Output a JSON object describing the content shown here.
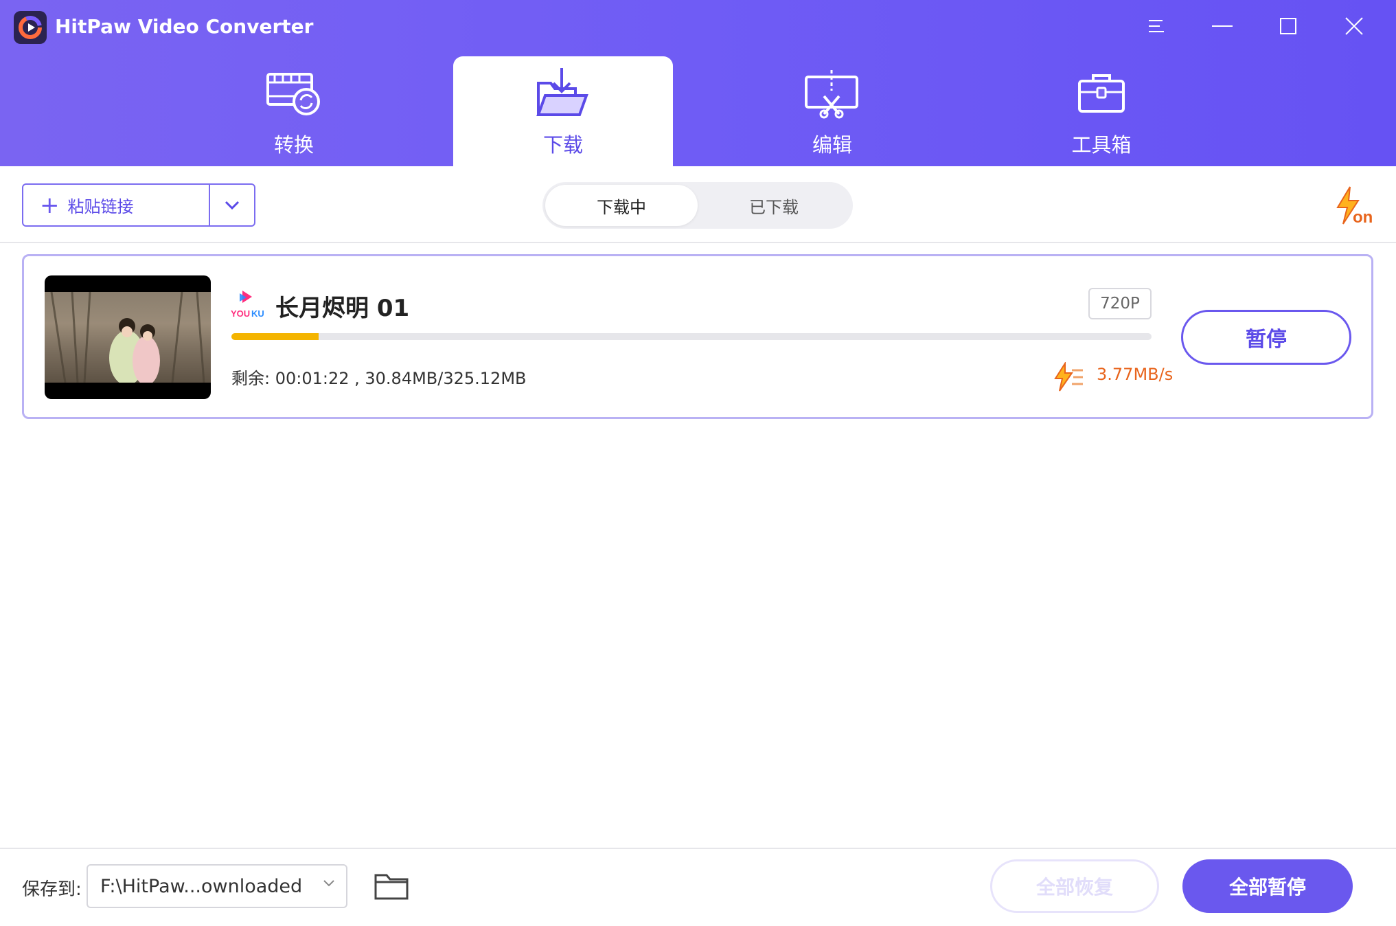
{
  "app": {
    "title": "HitPaw Video Converter"
  },
  "window_controls": [
    "menu-icon",
    "minimize-icon",
    "maximize-icon",
    "close-icon"
  ],
  "tabs": [
    {
      "label": "转换",
      "icon": "convert-icon",
      "active": false
    },
    {
      "label": "下载",
      "icon": "download-icon",
      "active": true
    },
    {
      "label": "编辑",
      "icon": "edit-icon",
      "active": false
    },
    {
      "label": "工具箱",
      "icon": "toolbox-icon",
      "active": false
    }
  ],
  "toolbar": {
    "paste_label": "粘贴链接",
    "segments": [
      {
        "label": "下载中",
        "selected": true
      },
      {
        "label": "已下载",
        "selected": false
      }
    ],
    "turbo_icon": "turbo-on-icon"
  },
  "downloads": [
    {
      "source": "YOUKU",
      "title": "长月烬明 01",
      "quality": "720P",
      "progress": 0.095,
      "remaining": "剩余: 00:01:22 , 30.84MB/325.12MB",
      "speed": "3.77MB/s",
      "action_label": "暂停"
    }
  ],
  "footer": {
    "save_label": "保存到:",
    "save_path": "F:\\HitPaw...ownloaded",
    "resume_all_label": "全部恢复",
    "pause_all_label": "全部暂停"
  },
  "colors": {
    "header": "#6f5cf5",
    "accent": "#6a58ee",
    "progress": "#f4b400",
    "speed": "#e8641c"
  }
}
